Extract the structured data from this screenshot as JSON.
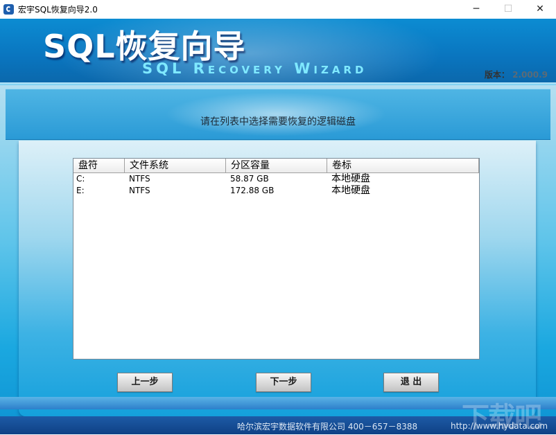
{
  "window": {
    "title": "宏宇SQL恢复向导2.0",
    "controls": {
      "minimize": "─",
      "maximize": "☐",
      "close": "✕"
    }
  },
  "banner": {
    "title": "SQL恢复向导",
    "subtitle": "SQL Recovery Wizard",
    "version_label": "版本：",
    "version_value": "2.000.9"
  },
  "instruction": "请在列表中选择需要恢复的逻辑磁盘",
  "table": {
    "columns": [
      "盘符",
      "文件系统",
      "分区容量",
      "卷标"
    ],
    "rows": [
      {
        "drive": "C:",
        "fs": "NTFS",
        "capacity": "58.87 GB",
        "label": "本地硬盘"
      },
      {
        "drive": "E:",
        "fs": "NTFS",
        "capacity": "172.88 GB",
        "label": "本地硬盘"
      }
    ]
  },
  "buttons": {
    "prev": "上一步",
    "next": "下一步",
    "exit": "退 出"
  },
  "footer": {
    "company": "哈尔滨宏宇数据软件有限公司  400－657－8388",
    "url": "http://www.hydata.com"
  },
  "watermark": "下载吧",
  "colors": {
    "banner": "#0a75bf",
    "panel": "#1ba8e0",
    "footer": "#1d5aa6"
  }
}
